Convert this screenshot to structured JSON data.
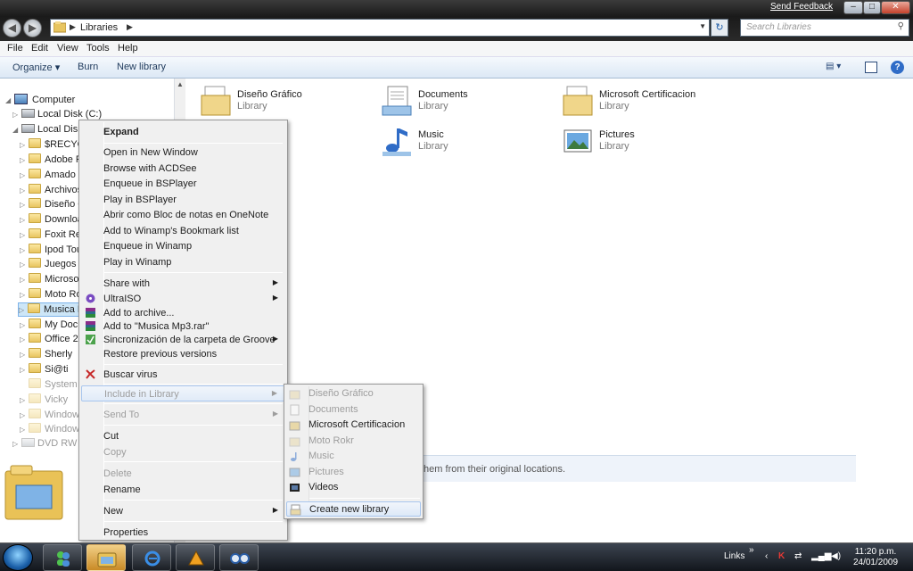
{
  "window": {
    "send_feedback": "Send Feedback",
    "min_glyph": "–",
    "max_glyph": "□",
    "close_glyph": "✕",
    "back_glyph": "◀",
    "forward_glyph": "▶"
  },
  "address": {
    "crumb": "Libraries",
    "separator": "▶",
    "dropdown": "▼",
    "refresh_glyph": "↻"
  },
  "search": {
    "placeholder": "Search Libraries",
    "icon": "⚲"
  },
  "menubar": [
    "File",
    "Edit",
    "View",
    "Tools",
    "Help"
  ],
  "toolbar": {
    "organize": "Organize ▾",
    "burn": "Burn",
    "new_library": "New library",
    "views_glyph": "▤ ▾",
    "help_glyph": "?"
  },
  "navpane": {
    "scroll_up": "▲",
    "items": [
      {
        "label": "Computer",
        "arrow": "◢"
      },
      {
        "label": "Local Disk (C:)",
        "arrow": "▷"
      },
      {
        "label": "Local Disk (",
        "arrow": "◢"
      },
      {
        "label": "$RECYCL",
        "arrow": "▷"
      },
      {
        "label": "Adobe Ph",
        "arrow": "▷"
      },
      {
        "label": "Amado",
        "arrow": "▷"
      },
      {
        "label": "Archivos",
        "arrow": "▷"
      },
      {
        "label": "Diseño Gr",
        "arrow": "▷"
      },
      {
        "label": "Download",
        "arrow": "▷"
      },
      {
        "label": "Foxit Rea",
        "arrow": "▷"
      },
      {
        "label": "Ipod Tou",
        "arrow": "▷"
      },
      {
        "label": "Juegos",
        "arrow": "▷"
      },
      {
        "label": "Microsof",
        "arrow": "▷"
      },
      {
        "label": "Moto Rok",
        "arrow": "▷"
      },
      {
        "label": "Musica M",
        "arrow": "▷"
      },
      {
        "label": "My Docu",
        "arrow": "▷"
      },
      {
        "label": "Office 20",
        "arrow": "▷"
      },
      {
        "label": "Sherly",
        "arrow": "▷"
      },
      {
        "label": "Si@ti",
        "arrow": "▷"
      },
      {
        "label": "System V",
        "arrow": ""
      },
      {
        "label": "Vicky",
        "arrow": "▷"
      },
      {
        "label": "Windows",
        "arrow": "▷"
      },
      {
        "label": "Windows",
        "arrow": "▷"
      },
      {
        "label": "DVD RW Dr",
        "arrow": "▷"
      }
    ]
  },
  "libraries": [
    {
      "name": "Diseño Gráfico",
      "type": "Library",
      "icon": "folder-library-icon"
    },
    {
      "name": "Documents",
      "type": "Library",
      "icon": "documents-library-icon"
    },
    {
      "name": "Microsoft Certificacion",
      "type": "Library",
      "icon": "folder-library-icon"
    },
    {
      "name": "Music",
      "type": "Library",
      "icon": "music-library-icon"
    },
    {
      "name": "Pictures",
      "type": "Library",
      "icon": "pictures-library-icon"
    }
  ],
  "infobar": {
    "text": "them from their original locations."
  },
  "context_menu": {
    "submenu_arrow": "▶",
    "items": [
      {
        "label": "Expand"
      },
      {
        "label": "Open in New Window"
      },
      {
        "label": "Browse with ACDSee"
      },
      {
        "label": "Enqueue in BSPlayer"
      },
      {
        "label": "Play in BSPlayer"
      },
      {
        "label": "Abrir como Bloc de notas en OneNote"
      },
      {
        "label": "Add to Winamp's Bookmark list"
      },
      {
        "label": "Enqueue in Winamp"
      },
      {
        "label": "Play in Winamp"
      },
      {
        "label": "Share with"
      },
      {
        "label": "UltraISO"
      },
      {
        "label": "Add to archive..."
      },
      {
        "label": "Add to \"Musica Mp3.rar\""
      },
      {
        "label": "Sincronización de la carpeta de Groove"
      },
      {
        "label": "Restore previous versions"
      },
      {
        "label": "Buscar virus"
      },
      {
        "label": "Include in Library"
      },
      {
        "label": "Send To"
      },
      {
        "label": "Cut"
      },
      {
        "label": "Copy"
      },
      {
        "label": "Delete"
      },
      {
        "label": "Rename"
      },
      {
        "label": "New"
      },
      {
        "label": "Properties"
      }
    ]
  },
  "include_submenu": {
    "items": [
      {
        "label": "Diseño Gráfico"
      },
      {
        "label": "Documents"
      },
      {
        "label": "Microsoft Certificacion"
      },
      {
        "label": "Moto Rokr"
      },
      {
        "label": "Music"
      },
      {
        "label": "Pictures"
      },
      {
        "label": "Videos"
      },
      {
        "label": "Create new library"
      }
    ]
  },
  "taskbar": {
    "links": "Links",
    "chevron": "»",
    "clock_time": "11:20 p.m.",
    "clock_date": "24/01/2009"
  },
  "colors": {
    "accent": "#1e395b",
    "highlight": "#cde6f7",
    "menu_bg": "#f0f0f0"
  }
}
